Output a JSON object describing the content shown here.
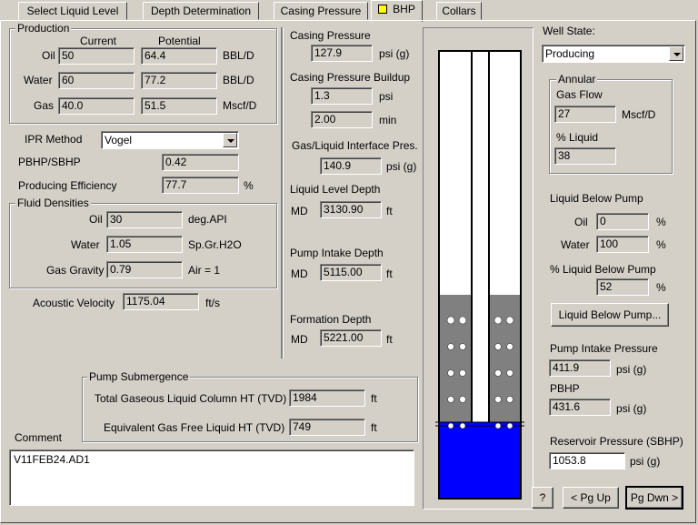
{
  "tabs": [
    {
      "label": "Select Liquid Level"
    },
    {
      "label": "Depth Determination"
    },
    {
      "label": "Casing Pressure"
    },
    {
      "label": "BHP"
    },
    {
      "label": "Collars"
    }
  ],
  "production": {
    "title": "Production",
    "current_header": "Current",
    "potential_header": "Potential",
    "rows": [
      {
        "label": "Oil",
        "current": "50",
        "potential": "64.4",
        "unit": "BBL/D"
      },
      {
        "label": "Water",
        "current": "60",
        "potential": "77.2",
        "unit": "BBL/D"
      },
      {
        "label": "Gas",
        "current": "40.0",
        "potential": "51.5",
        "unit": "Mscf/D"
      }
    ]
  },
  "ipr": {
    "label": "IPR Method",
    "value": "Vogel",
    "pbhp_label": "PBHP/SBHP",
    "pbhp_value": "0.42",
    "eff_label": "Producing Efficiency",
    "eff_value": "77.7",
    "eff_unit": "%"
  },
  "fluid": {
    "title": "Fluid Densities",
    "oil_label": "Oil",
    "oil_value": "30",
    "oil_unit": "deg.API",
    "water_label": "Water",
    "water_value": "1.05",
    "water_unit": "Sp.Gr.H2O",
    "gas_label": "Gas Gravity",
    "gas_value": "0.79",
    "gas_unit": "Air = 1"
  },
  "acoustic": {
    "label": "Acoustic Velocity",
    "value": "1175.04",
    "unit": "ft/s"
  },
  "pump_sub": {
    "title": "Pump Submergence",
    "total_label": "Total Gaseous Liquid Column HT  (TVD)",
    "total_value": "1984",
    "total_unit": "ft",
    "equiv_label": "Equivalent Gas Free Liquid HT  (TVD)",
    "equiv_value": "749",
    "equiv_unit": "ft"
  },
  "comment": {
    "label": "Comment",
    "value": "V11FEB24.AD1"
  },
  "middle": {
    "casing_pressure_label": "Casing Pressure",
    "casing_pressure_value": "127.9",
    "casing_pressure_unit": "psi (g)",
    "buildup_label": "Casing Pressure Buildup",
    "buildup_psi": "1.3",
    "buildup_psi_unit": "psi",
    "buildup_min": "2.00",
    "buildup_min_unit": "min",
    "interface_label": "Gas/Liquid Interface Pres.",
    "interface_value": "140.9",
    "interface_unit": "psi (g)",
    "liquid_level_label": "Liquid Level Depth",
    "liquid_level_md": "MD",
    "liquid_level_value": "3130.90",
    "liquid_level_unit": "ft",
    "pump_intake_label": "Pump Intake Depth",
    "pump_intake_md": "MD",
    "pump_intake_value": "5115.00",
    "pump_intake_unit": "ft",
    "formation_label": "Formation Depth",
    "formation_md": "MD",
    "formation_value": "5221.00",
    "formation_unit": "ft"
  },
  "right": {
    "well_state_label": "Well State:",
    "well_state_value": "Producing",
    "annular_title": "Annular",
    "gas_flow_label": "Gas Flow",
    "gas_flow_value": "27",
    "gas_flow_unit": "Mscf/D",
    "pct_liquid_label": "% Liquid",
    "pct_liquid_value": "38",
    "lbp_title": "Liquid Below Pump",
    "lbp_oil_label": "Oil",
    "lbp_oil_value": "0",
    "lbp_oil_unit": "%",
    "lbp_water_label": "Water",
    "lbp_water_value": "100",
    "lbp_water_unit": "%",
    "pct_lbp_label": "% Liquid Below Pump",
    "pct_lbp_value": "52",
    "pct_lbp_unit": "%",
    "lbp_button": "Liquid Below Pump...",
    "pip_label": "Pump Intake Pressure",
    "pip_value": "411.9",
    "pip_unit": "psi (g)",
    "pbhp_label": "PBHP",
    "pbhp_value": "431.6",
    "pbhp_unit": "psi (g)",
    "sbhp_label": "Reservoir Pressure (SBHP)",
    "sbhp_value": "1053.8",
    "sbhp_unit": "psi (g)"
  },
  "buttons": {
    "help": "?",
    "pgup": "< Pg Up",
    "pgdn": "Pg Dwn >"
  },
  "colors": {
    "liquid": "#0000ff",
    "gas_column": "#808080",
    "tubing": "#ffffff",
    "tab_marker": "#ffff00"
  }
}
